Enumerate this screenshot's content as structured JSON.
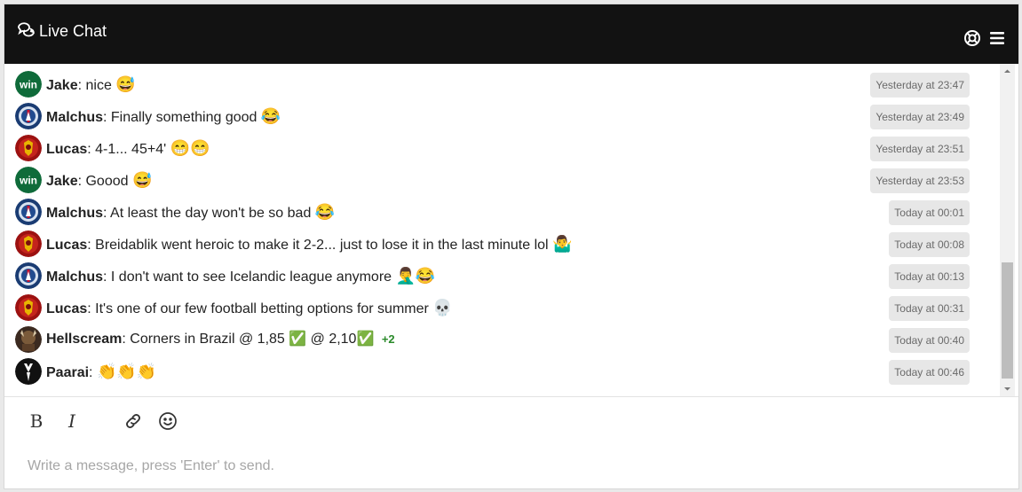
{
  "header": {
    "title": "Live Chat",
    "icons": [
      "chat-bubbles-icon",
      "lifebuoy-icon",
      "hamburger-menu-icon"
    ]
  },
  "messages": [
    {
      "name": "Jake",
      "text": "nice",
      "emoji": "😅",
      "time": "Yesterday at 23:47",
      "avatar": "win-avatar"
    },
    {
      "name": "Malchus",
      "text": "Finally something good",
      "emoji": "😂",
      "time": "Yesterday at 23:49",
      "avatar": "psg-avatar"
    },
    {
      "name": "Lucas",
      "text": "4-1... 45+4'",
      "emoji": "😁😁",
      "time": "Yesterday at 23:51",
      "avatar": "red-crest-avatar"
    },
    {
      "name": "Jake",
      "text": "Goood",
      "emoji": "😅",
      "time": "Yesterday at 23:53",
      "avatar": "win-avatar"
    },
    {
      "name": "Malchus",
      "text": "At least the day won't be so bad",
      "emoji": "😂",
      "time": "Today at 00:01",
      "avatar": "psg-avatar"
    },
    {
      "name": "Lucas",
      "text": "Breidablik went heroic to make it 2-2... just to lose it in the last minute lol",
      "emoji": "🤷‍♂️",
      "time": "Today at 00:08",
      "avatar": "red-crest-avatar"
    },
    {
      "name": "Malchus",
      "text": "I don't want to see Icelandic league anymore",
      "emoji": "🤦‍♂️😂",
      "time": "Today at 00:13",
      "avatar": "psg-avatar"
    },
    {
      "name": "Lucas",
      "text": "It's one of our few football betting options for summer",
      "emoji": "💀",
      "time": "Today at 00:31",
      "avatar": "red-crest-avatar"
    },
    {
      "name": "Hellscream",
      "text": "Corners in Brazil @ 1,85 ✅ @ 2,10✅",
      "emoji": "",
      "extra": "+2",
      "time": "Today at 00:40",
      "avatar": "warrior-avatar"
    },
    {
      "name": "Paarai",
      "text": "",
      "emoji": "👏👏👏",
      "time": "Today at 00:46",
      "avatar": "suit-avatar"
    }
  ],
  "toolbar": {
    "bold_label": "B",
    "italic_label": "I",
    "icons": [
      "link-icon",
      "smiley-icon"
    ]
  },
  "composer": {
    "placeholder": "Write a message, press 'Enter' to send.",
    "value": ""
  },
  "colors": {
    "header_bg": "#121212",
    "time_badge_bg": "#e7e7e7",
    "win_green": "#0f6b3a",
    "plus_green": "#2a8a2a"
  }
}
